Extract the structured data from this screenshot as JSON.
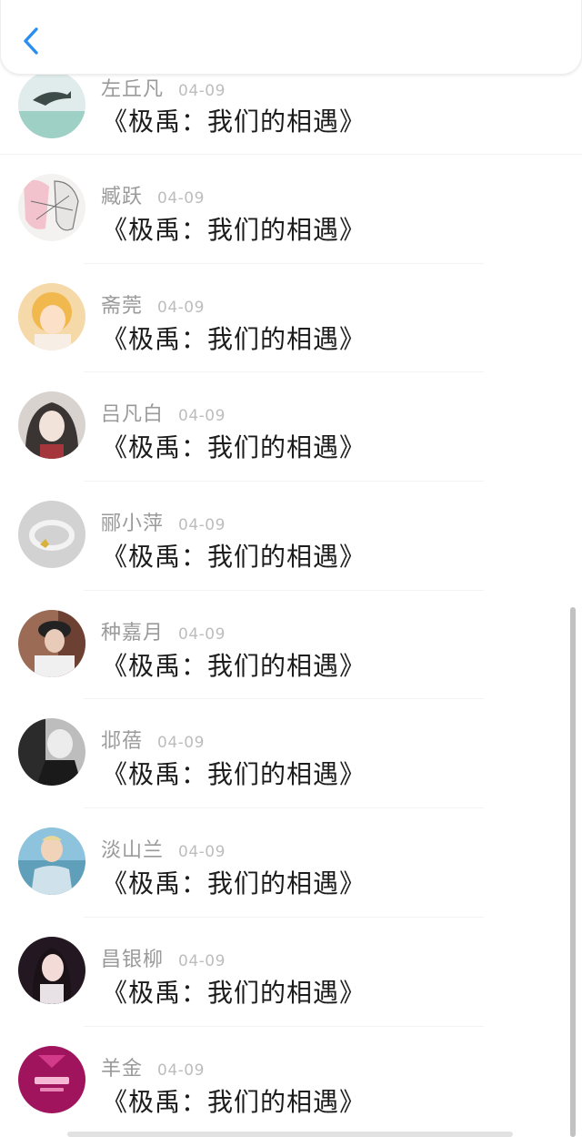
{
  "nav": {
    "back_icon": "chevron-left-icon",
    "accent": "#2b8ef0"
  },
  "items": [
    {
      "name": "左丘凡",
      "date": "04-09",
      "title": "《极禹：我们的相遇》",
      "avatar": "dolphin"
    },
    {
      "name": "臧跃",
      "date": "04-09",
      "title": "《极禹：我们的相遇》",
      "avatar": "sketch"
    },
    {
      "name": "斋莞",
      "date": "04-09",
      "title": "《极禹：我们的相遇》",
      "avatar": "blonde-girl"
    },
    {
      "name": "吕凡白",
      "date": "04-09",
      "title": "《极禹：我们的相遇》",
      "avatar": "dark-hair-girl"
    },
    {
      "name": "郦小萍",
      "date": "04-09",
      "title": "《极禹：我们的相遇》",
      "avatar": "ring"
    },
    {
      "name": "种嘉月",
      "date": "04-09",
      "title": "《极禹：我们的相遇》",
      "avatar": "cap-boy"
    },
    {
      "name": "邶蓓",
      "date": "04-09",
      "title": "《极禹：我们的相遇》",
      "avatar": "monochrome"
    },
    {
      "name": "淡山兰",
      "date": "04-09",
      "title": "《极禹：我们的相遇》",
      "avatar": "beach-man"
    },
    {
      "name": "昌银柳",
      "date": "04-09",
      "title": "《极禹：我们的相遇》",
      "avatar": "pink-girl"
    },
    {
      "name": "羊金",
      "date": "04-09",
      "title": "《极禹：我们的相遇》",
      "avatar": "magenta-logo"
    }
  ]
}
